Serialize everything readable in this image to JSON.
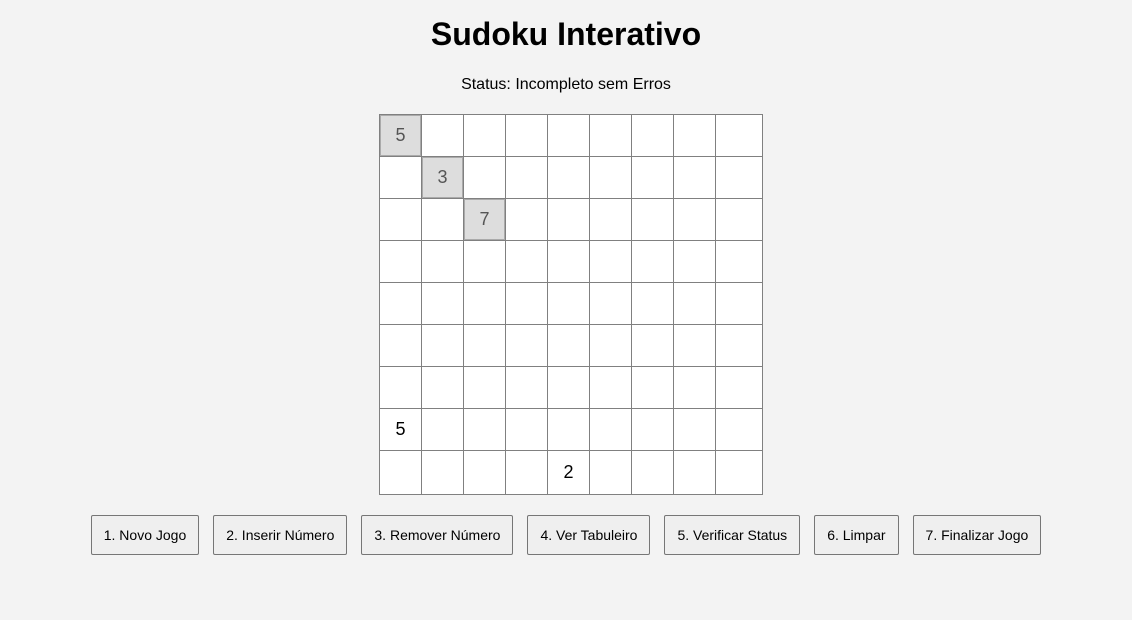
{
  "title": "Sudoku Interativo",
  "status": "Status: Incompleto sem Erros",
  "board": [
    [
      5,
      0,
      0,
      0,
      0,
      0,
      0,
      0,
      0
    ],
    [
      0,
      3,
      0,
      0,
      0,
      0,
      0,
      0,
      0
    ],
    [
      0,
      0,
      7,
      0,
      0,
      0,
      0,
      0,
      0
    ],
    [
      0,
      0,
      0,
      0,
      0,
      0,
      0,
      0,
      0
    ],
    [
      0,
      0,
      0,
      0,
      0,
      0,
      0,
      0,
      0
    ],
    [
      0,
      0,
      0,
      0,
      0,
      0,
      0,
      0,
      0
    ],
    [
      0,
      0,
      0,
      0,
      0,
      0,
      0,
      0,
      0
    ],
    [
      5,
      0,
      0,
      0,
      0,
      0,
      0,
      0,
      0
    ],
    [
      0,
      0,
      0,
      0,
      2,
      0,
      0,
      0,
      0
    ]
  ],
  "fixed": [
    [
      0,
      0
    ],
    [
      1,
      1
    ],
    [
      2,
      2
    ]
  ],
  "buttons": [
    "1. Novo Jogo",
    "2. Inserir Número",
    "3. Remover Número",
    "4. Ver Tabuleiro",
    "5. Verificar Status",
    "6. Limpar",
    "7. Finalizar Jogo"
  ]
}
